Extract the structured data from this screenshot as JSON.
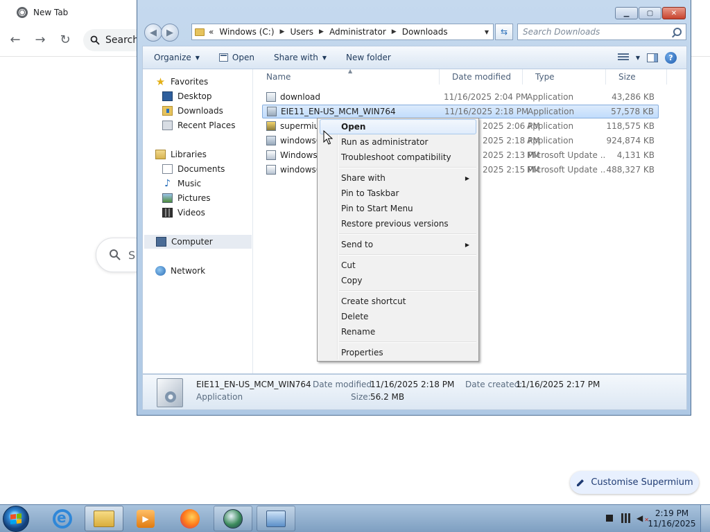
{
  "browser": {
    "tab_title": "New Tab",
    "omnibox_text": "Search",
    "ntp_search_text": "S",
    "customise_label": "Customise Supermium"
  },
  "explorer": {
    "address": {
      "overflow": "«",
      "crumbs": [
        "Windows (C:)",
        "Users",
        "Administrator",
        "Downloads"
      ]
    },
    "search_placeholder": "Search Downloads",
    "toolbar": {
      "organize": "Organize",
      "open": "Open",
      "share_with": "Share with",
      "new_folder": "New folder"
    },
    "nav": {
      "favorites": "Favorites",
      "desktop": "Desktop",
      "downloads": "Downloads",
      "recent_places": "Recent Places",
      "libraries": "Libraries",
      "documents": "Documents",
      "music": "Music",
      "pictures": "Pictures",
      "videos": "Videos",
      "computer": "Computer",
      "network": "Network"
    },
    "columns": {
      "name": "Name",
      "date_modified": "Date modified",
      "type": "Type",
      "size": "Size"
    },
    "files": [
      {
        "name": "download",
        "date": "11/16/2025 2:04 PM",
        "type": "Application",
        "size": "43,286 KB"
      },
      {
        "name": "EIE11_EN-US_MCM_WIN764",
        "date": "11/16/2025 2:18 PM",
        "type": "Application",
        "size": "57,578 KB"
      },
      {
        "name": "supermium",
        "date": "2025 2:06 PM",
        "type": "Application",
        "size": "118,575 KB"
      },
      {
        "name": "windows6",
        "date": "2025 2:18 PM",
        "type": "Application",
        "size": "924,874 KB"
      },
      {
        "name": "Windows6",
        "date": "2025 2:13 PM",
        "type": "Microsoft Update ...",
        "size": "4,131 KB"
      },
      {
        "name": "windows6",
        "date": "2025 2:15 PM",
        "type": "Microsoft Update ...",
        "size": "488,327 KB"
      }
    ],
    "details": {
      "name": "EIE11_EN-US_MCM_WIN764",
      "type": "Application",
      "date_modified_label": "Date modified:",
      "date_modified": "11/16/2025 2:18 PM",
      "date_created_label": "Date created:",
      "date_created": "11/16/2025 2:17 PM",
      "size_label": "Size:",
      "size": "56.2 MB"
    }
  },
  "context_menu": {
    "open": "Open",
    "run_as_admin": "Run as administrator",
    "troubleshoot": "Troubleshoot compatibility",
    "share_with": "Share with",
    "pin_taskbar": "Pin to Taskbar",
    "pin_start": "Pin to Start Menu",
    "restore": "Restore previous versions",
    "send_to": "Send to",
    "cut": "Cut",
    "copy": "Copy",
    "create_shortcut": "Create shortcut",
    "delete": "Delete",
    "rename": "Rename",
    "properties": "Properties"
  },
  "taskbar": {
    "time": "2:19 PM",
    "date": "11/16/2025"
  },
  "colors": {
    "selection_fill": "#c1dcfc",
    "selection_border": "#84acdd",
    "taskbar": "#7e9fc1",
    "close_button": "#c8432e"
  }
}
